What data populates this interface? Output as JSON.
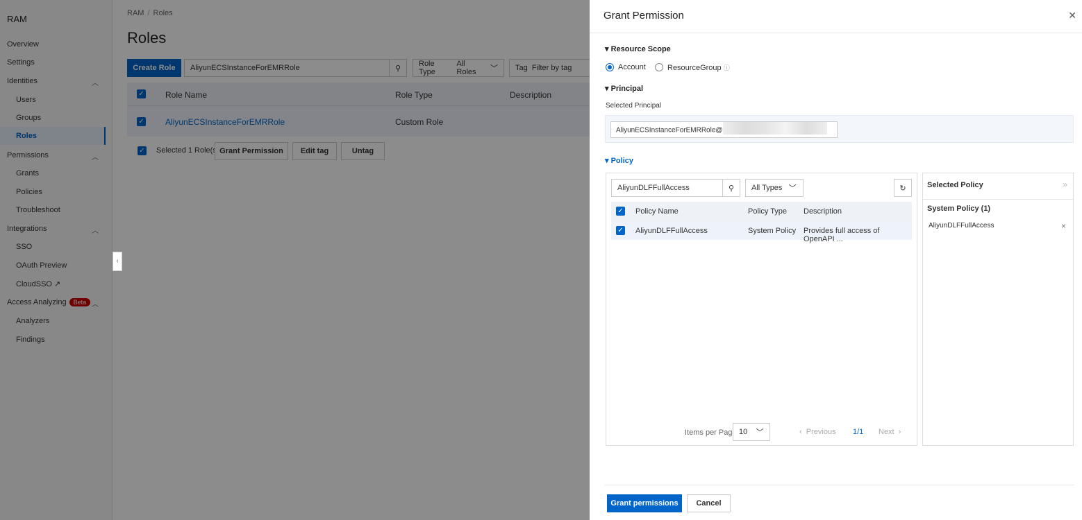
{
  "sidebar": {
    "title": "RAM",
    "items": [
      {
        "label": "Overview"
      },
      {
        "label": "Settings"
      },
      {
        "label": "Identities"
      },
      {
        "label": "Users"
      },
      {
        "label": "Groups"
      },
      {
        "label": "Roles"
      },
      {
        "label": "Permissions"
      },
      {
        "label": "Grants"
      },
      {
        "label": "Policies"
      },
      {
        "label": "Troubleshoot"
      },
      {
        "label": "Integrations"
      },
      {
        "label": "SSO"
      },
      {
        "label": "OAuth Preview"
      },
      {
        "label": "CloudSSO"
      },
      {
        "label": "Access Analyzing"
      },
      {
        "label": "Analyzers"
      },
      {
        "label": "Findings"
      }
    ],
    "beta_badge": "Beta"
  },
  "main": {
    "breadcrumb": [
      "RAM",
      "Roles"
    ],
    "title": "Roles",
    "create_role": "Create Role",
    "search_value": "AliyunECSInstanceForEMRRole",
    "role_type_label": "Role Type",
    "role_type_value": "All Roles",
    "tag_label": "Tag",
    "tag_placeholder": "Filter by tag",
    "columns": [
      "Role Name",
      "Role Type",
      "Description"
    ],
    "rows": [
      {
        "name": "AliyunECSInstanceForEMRRole",
        "type": "Custom Role"
      }
    ],
    "selected_text": "Selected 1 Role(s)",
    "grant_permission": "Grant Permission",
    "edit_tag": "Edit tag",
    "untag": "Untag"
  },
  "drawer": {
    "title": "Grant Permission",
    "resource_scope": "Resource Scope",
    "scope_options": [
      "Account",
      "ResourceGroup"
    ],
    "scope_selected": "Account",
    "principal": "Principal",
    "selected_principal_label": "Selected Principal",
    "principal_value": "AliyunECSInstanceForEMRRole@",
    "policy": "Policy",
    "policy_search": "AliyunDLFFullAccess",
    "type_filter": "All Types",
    "policy_columns": [
      "Policy Name",
      "Policy Type",
      "Description"
    ],
    "policy_rows": [
      {
        "name": "AliyunDLFFullAccess",
        "type": "System Policy",
        "description": "Provides full access of OpenAPI ..."
      }
    ],
    "items_per_page_label": "Items per Page",
    "items_per_page": "10",
    "previous": "Previous",
    "page": "1/1",
    "next": "Next",
    "selected_policy": "Selected Policy",
    "system_policy_group": "System Policy (1)",
    "selected_items": [
      "AliyunDLFFullAccess"
    ],
    "grant_button": "Grant permissions",
    "cancel_button": "Cancel"
  },
  "colors": {
    "accent": "#0064c8"
  }
}
